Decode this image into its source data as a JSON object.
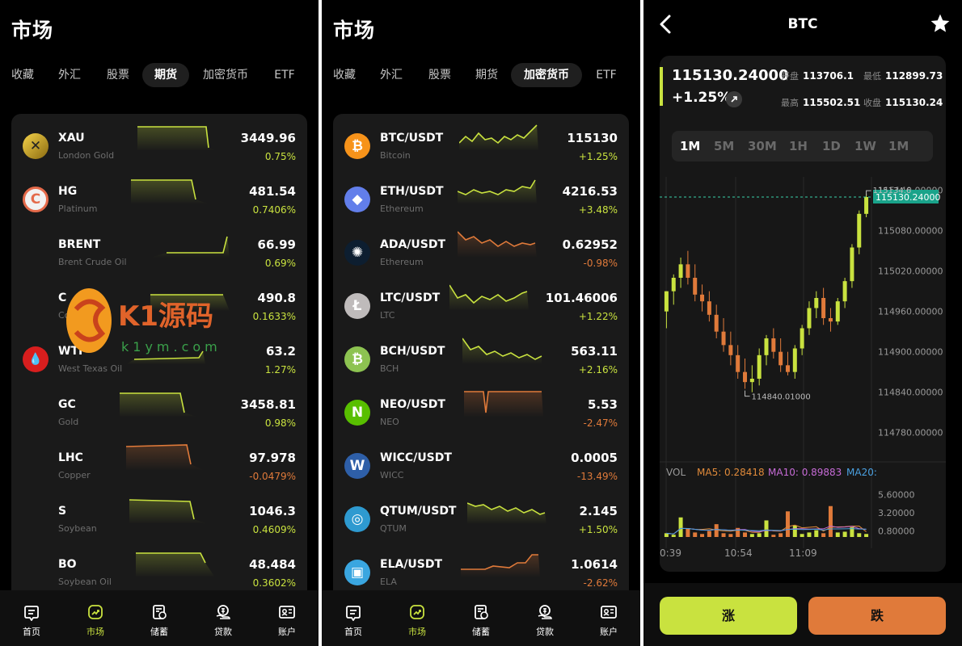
{
  "colors": {
    "up": "#c9e23f",
    "down": "#e07a3a",
    "accent": "#c9e23f",
    "ma5": "#e08a3a",
    "ma10": "#c66bd6",
    "ma20": "#4aa0e0"
  },
  "s1": {
    "title": "市场",
    "tabs": [
      "收藏",
      "外汇",
      "股票",
      "期货",
      "加密货币",
      "ETF"
    ],
    "rows": [
      {
        "sym": "XAU",
        "sub": "London Gold",
        "price": "3449.96",
        "chg": "0.75%",
        "dir": "up",
        "icon": "gold-icon"
      },
      {
        "sym": "HG",
        "sub": "Platinum",
        "price": "481.54",
        "chg": "0.7406%",
        "dir": "up",
        "icon": "platinum-icon"
      },
      {
        "sym": "BRENT",
        "sub": "Brent Crude Oil",
        "price": "66.99",
        "chg": "0.69%",
        "dir": "up",
        "icon": ""
      },
      {
        "sym": "C",
        "sub": "Corn",
        "price": "490.8",
        "chg": "0.1633%",
        "dir": "up",
        "icon": ""
      },
      {
        "sym": "WTI",
        "sub": "West Texas Oil",
        "price": "63.2",
        "chg": "1.27%",
        "dir": "up",
        "icon": "oil-drop-icon"
      },
      {
        "sym": "GC",
        "sub": "Gold",
        "price": "3458.81",
        "chg": "0.98%",
        "dir": "up",
        "icon": ""
      },
      {
        "sym": "LHC",
        "sub": "Copper",
        "price": "97.978",
        "chg": "-0.0479%",
        "dir": "down",
        "icon": ""
      },
      {
        "sym": "S",
        "sub": "Soybean",
        "price": "1046.3",
        "chg": "0.4609%",
        "dir": "up",
        "icon": ""
      },
      {
        "sym": "BO",
        "sub": "Soybean Oil",
        "price": "48.484",
        "chg": "0.3602%",
        "dir": "up",
        "icon": ""
      }
    ]
  },
  "s2": {
    "title": "市场",
    "tabs": [
      "收藏",
      "外汇",
      "股票",
      "期货",
      "加密货币",
      "ETF"
    ],
    "rows": [
      {
        "sym": "BTC/USDT",
        "sub": "Bitcoin",
        "price": "115130",
        "chg": "+1.25%",
        "dir": "up",
        "icon": "bitcoin-icon",
        "glyph": "₿",
        "color": "#f7931a"
      },
      {
        "sym": "ETH/USDT",
        "sub": "Ethereum",
        "price": "4216.53",
        "chg": "+3.48%",
        "dir": "up",
        "icon": "ethereum-icon",
        "glyph": "◆",
        "color": "#627eea"
      },
      {
        "sym": "ADA/USDT",
        "sub": "Ethereum",
        "price": "0.62952",
        "chg": "-0.98%",
        "dir": "down",
        "icon": "cardano-icon",
        "glyph": "✺",
        "color": "#0d1e30"
      },
      {
        "sym": "LTC/USDT",
        "sub": "LTC",
        "price": "101.46006",
        "chg": "+1.22%",
        "dir": "up",
        "icon": "litecoin-icon",
        "glyph": "Ł",
        "color": "#bfbbbb"
      },
      {
        "sym": "BCH/USDT",
        "sub": "BCH",
        "price": "563.11",
        "chg": "+2.16%",
        "dir": "up",
        "icon": "bitcoin-cash-icon",
        "glyph": "₿",
        "color": "#8dc351"
      },
      {
        "sym": "NEO/USDT",
        "sub": "NEO",
        "price": "5.53",
        "chg": "-2.47%",
        "dir": "down",
        "icon": "neo-icon",
        "glyph": "N",
        "color": "#58bf00"
      },
      {
        "sym": "WICC/USDT",
        "sub": "WICC",
        "price": "0.0005",
        "chg": "-13.49%",
        "dir": "down",
        "icon": "wicc-icon",
        "glyph": "W",
        "color": "#2e5fa8"
      },
      {
        "sym": "QTUM/USDT",
        "sub": "QTUM",
        "price": "2.145",
        "chg": "+1.50%",
        "dir": "up",
        "icon": "qtum-icon",
        "glyph": "◎",
        "color": "#2e9ad0"
      },
      {
        "sym": "ELA/USDT",
        "sub": "ELA",
        "price": "1.0614",
        "chg": "-2.62%",
        "dir": "down",
        "icon": "ela-icon",
        "glyph": "▣",
        "color": "#3aa6e0"
      }
    ]
  },
  "nav": [
    "首页",
    "市场",
    "储蓄",
    "贷款",
    "账户"
  ],
  "watermark": {
    "brand": "K1源码",
    "domain": "k1ym.com"
  },
  "s3": {
    "title": "BTC",
    "price": "115130.24000",
    "change": "+1.25%",
    "stats": {
      "open_label": "开盘",
      "open": "113706.1",
      "low_label": "最低",
      "low": "112899.73",
      "high_label": "最高",
      "high": "115502.51",
      "close_label": "收盘",
      "close": "115130.24"
    },
    "timeframes": [
      "1M",
      "5M",
      "30M",
      "1H",
      "1D",
      "1W",
      "1M"
    ],
    "active_timeframe": 0,
    "buy_label": "涨",
    "sell_label": "跌"
  },
  "chart_data": {
    "type": "candlestick",
    "ylim": [
      114740,
      115160
    ],
    "y_ticks": [
      "115140.00000",
      "115080.00000",
      "115020.00000",
      "114960.00000",
      "114900.00000",
      "114840.00000",
      "114780.00000"
    ],
    "current_price_label": "115130.24000",
    "max_label": "115134.6",
    "min_label": "114840.01000",
    "x_ticks": [
      "0:39",
      "10:54",
      "11:09"
    ],
    "volume": {
      "label": "VOL",
      "ma5": "MA5: 0.28418",
      "ma10": "MA10: 0.89883",
      "ma20": "MA20:",
      "ticks": [
        "5.60000",
        "3.20000",
        "0.80000"
      ],
      "ylim": [
        0,
        6
      ]
    },
    "candles": [
      [
        114960,
        114990,
        114935,
        114990,
        0.5
      ],
      [
        114990,
        115015,
        114970,
        115010,
        0.3
      ],
      [
        115010,
        115040,
        114995,
        115030,
        2.6
      ],
      [
        115030,
        115050,
        115000,
        115010,
        1.1
      ],
      [
        115010,
        115030,
        114975,
        114985,
        0.6
      ],
      [
        114985,
        115000,
        114960,
        114975,
        0.4
      ],
      [
        114975,
        114990,
        114945,
        114955,
        0.8
      ],
      [
        114955,
        114970,
        114920,
        114930,
        1.7
      ],
      [
        114930,
        114950,
        114900,
        114910,
        0.5
      ],
      [
        114910,
        114930,
        114880,
        114895,
        0.4
      ],
      [
        114895,
        114910,
        114860,
        114870,
        1.2
      ],
      [
        114870,
        114890,
        114845,
        114855,
        0.6
      ],
      [
        114855,
        114880,
        114840,
        114860,
        0.4
      ],
      [
        114860,
        114905,
        114850,
        114895,
        0.5
      ],
      [
        114895,
        114925,
        114880,
        114920,
        2.2
      ],
      [
        114920,
        114935,
        114890,
        114900,
        0.3
      ],
      [
        114900,
        114920,
        114870,
        114880,
        0.5
      ],
      [
        114880,
        114900,
        114865,
        114870,
        3.4
      ],
      [
        114870,
        114910,
        114860,
        114905,
        1.5
      ],
      [
        114905,
        114940,
        114895,
        114935,
        0.4
      ],
      [
        114935,
        114975,
        114925,
        114965,
        0.6
      ],
      [
        114965,
        114990,
        114950,
        114980,
        0.9
      ],
      [
        114980,
        114995,
        114940,
        114950,
        0.5
      ],
      [
        114950,
        114965,
        114930,
        114945,
        4.1
      ],
      [
        114945,
        114980,
        114940,
        114975,
        0.6
      ],
      [
        114975,
        115010,
        114965,
        115005,
        0.7
      ],
      [
        115005,
        115060,
        114995,
        115055,
        1.3
      ],
      [
        115055,
        115110,
        115045,
        115105,
        0.5
      ],
      [
        115105,
        115135,
        115100,
        115130,
        0.4
      ]
    ]
  }
}
